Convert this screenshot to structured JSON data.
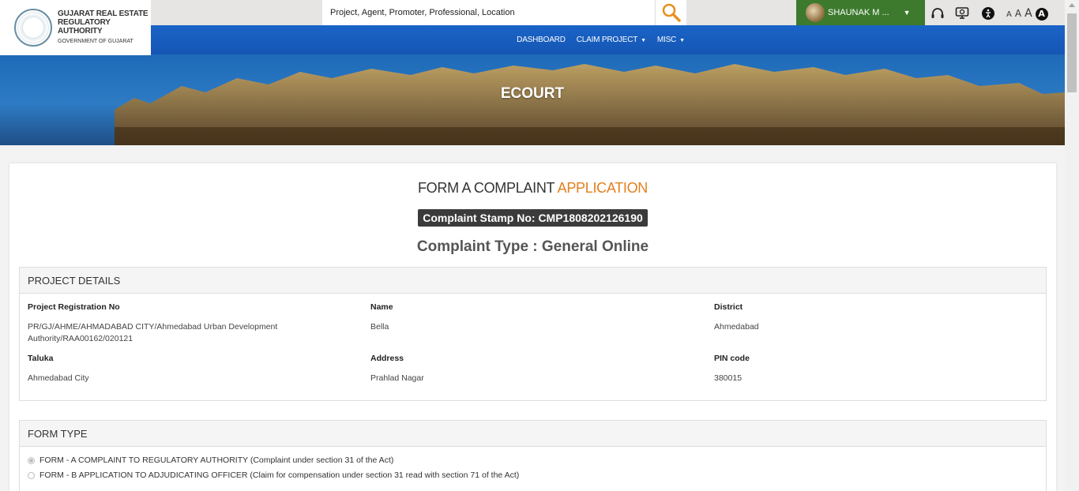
{
  "logo": {
    "line1": "GUJARAT REAL ESTATE",
    "line2": "REGULATORY AUTHORITY",
    "line3": "GOVERNMENT OF GUJARAT"
  },
  "search": {
    "placeholder": "Project, Agent, Promoter, Professional, Location"
  },
  "user": {
    "name": "SHAUNAK M ..."
  },
  "font_sizes": {
    "small": "A",
    "medium": "A",
    "large": "A",
    "contrast": "A"
  },
  "nav": {
    "items": [
      {
        "label": "DASHBOARD",
        "dropdown": false
      },
      {
        "label": "CLAIM PROJECT",
        "dropdown": true
      },
      {
        "label": "MISC",
        "dropdown": true
      }
    ]
  },
  "banner": {
    "title": "ECOURT"
  },
  "form": {
    "title_main": "FORM A  COMPLAINT",
    "title_accent": "APPLICATION",
    "stamp": "Complaint Stamp No: CMP1808202126190",
    "complaint_type": "Complaint Type : General Online"
  },
  "project_details": {
    "heading": "PROJECT DETAILS",
    "fields": [
      {
        "label": "Project Registration No",
        "value": "PR/GJ/AHME/AHMADABAD CITY/Ahmedabad Urban Development Authority/RAA00162/020121"
      },
      {
        "label": "Name",
        "value": "Bella"
      },
      {
        "label": "District",
        "value": "Ahmedabad"
      },
      {
        "label": "Taluka",
        "value": "Ahmedabad City"
      },
      {
        "label": "Address",
        "value": "Prahlad Nagar"
      },
      {
        "label": "PIN code",
        "value": "380015"
      }
    ]
  },
  "form_type": {
    "heading": "FORM TYPE",
    "options": [
      {
        "label": "FORM - A COMPLAINT TO REGULATORY AUTHORITY (Complaint under section 31 of the Act)",
        "checked": true
      },
      {
        "label": "FORM - B APPLICATION TO ADJUDICATING OFFICER (Claim for compensation under section 31 read with section 71 of the Act)",
        "checked": false
      }
    ]
  },
  "colors": {
    "nav_blue": "#1a64c7",
    "user_green": "#3d7a2e",
    "accent_orange": "#e47f1c"
  },
  "icons": [
    "search-icon",
    "headset-icon",
    "screen-reader-icon",
    "accessibility-icon",
    "chevron-down-icon"
  ]
}
